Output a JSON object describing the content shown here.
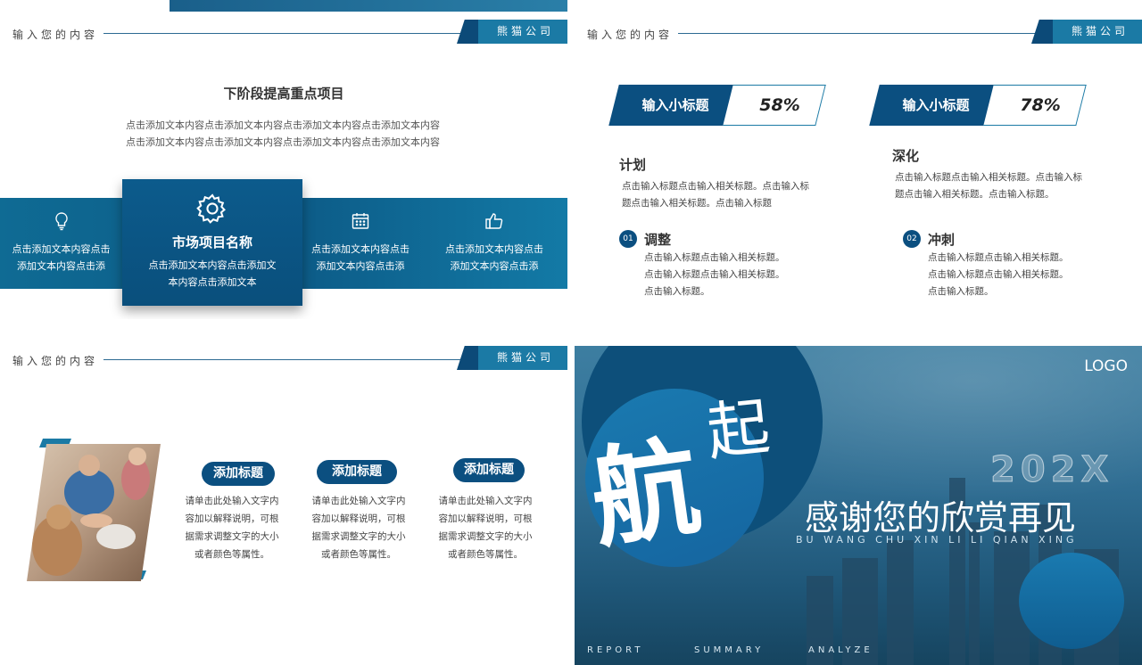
{
  "header": {
    "text": "输入您的内容",
    "brand": "熊猫公司"
  },
  "slide1": {
    "title": "下阶段提高重点项目",
    "desc": [
      "点击添加文本内容点击添加文本内容点击添加文本内容点击添加文本内容",
      "点击添加文本内容点击添加文本内容点击添加文本内容点击添加文本内容"
    ],
    "items": [
      {
        "icon": "lightbulb-icon",
        "lines": [
          "点击添加文本内容点击",
          "添加文本内容点击添"
        ]
      },
      {
        "icon": "gear-icon",
        "name": "市场项目名称",
        "lines": [
          "点击添加文本内容点击添加文",
          "本内容点击添加文本"
        ]
      },
      {
        "icon": "calendar-icon",
        "lines": [
          "点击添加文本内容点击",
          "添加文本内容点击添"
        ]
      },
      {
        "icon": "thumbs-up-icon",
        "lines": [
          "点击添加文本内容点击",
          "添加文本内容点击添"
        ]
      }
    ]
  },
  "slide2": {
    "tags": [
      {
        "label": "输入小标题",
        "pct": "58%"
      },
      {
        "label": "输入小标题",
        "pct": "78%"
      }
    ],
    "left": {
      "h1": "计划",
      "p1": [
        "点击输入标题点击输入相关标题。点击输入标",
        "题点击输入相关标题。点击输入标题"
      ],
      "num": "01",
      "h2": "调整",
      "p2": [
        "点击输入标题点击输入相关标题。",
        "点击输入标题点击输入相关标题。",
        "点击输入标题。"
      ]
    },
    "right": {
      "h1": "深化",
      "p1": [
        "点击输入标题点击输入相关标题。点击输入标",
        "题点击输入相关标题。点击输入标题。"
      ],
      "num": "02",
      "h2": "冲刺",
      "p2": [
        "点击输入标题点击输入相关标题。",
        "点击输入标题点击输入相关标题。",
        "点击输入标题。"
      ]
    }
  },
  "slide3": {
    "items": [
      {
        "title": "添加标题",
        "lines": [
          "请单击此处输入文字内",
          "容加以解释说明，可根",
          "据需求调整文字的大小",
          "或者颜色等属性。"
        ]
      },
      {
        "title": "添加标题",
        "lines": [
          "请单击此处输入文字内",
          "容加以解释说明，可根",
          "据需求调整文字的大小",
          "或者颜色等属性。"
        ]
      },
      {
        "title": "添加标题",
        "lines": [
          "请单击此处输入文字内",
          "容加以解释说明，可根",
          "据需求调整文字的大小",
          "或者颜色等属性。"
        ]
      }
    ]
  },
  "slide4": {
    "logo": "LOGO",
    "year": "202X",
    "big": "感谢您的欣赏再见",
    "pinyin": "BU WANG CHU XIN   LI LI QIAN XING",
    "callig1": "航",
    "callig2": "起",
    "footer": [
      "REPORT",
      "SUMMARY",
      "ANALYZE"
    ]
  }
}
